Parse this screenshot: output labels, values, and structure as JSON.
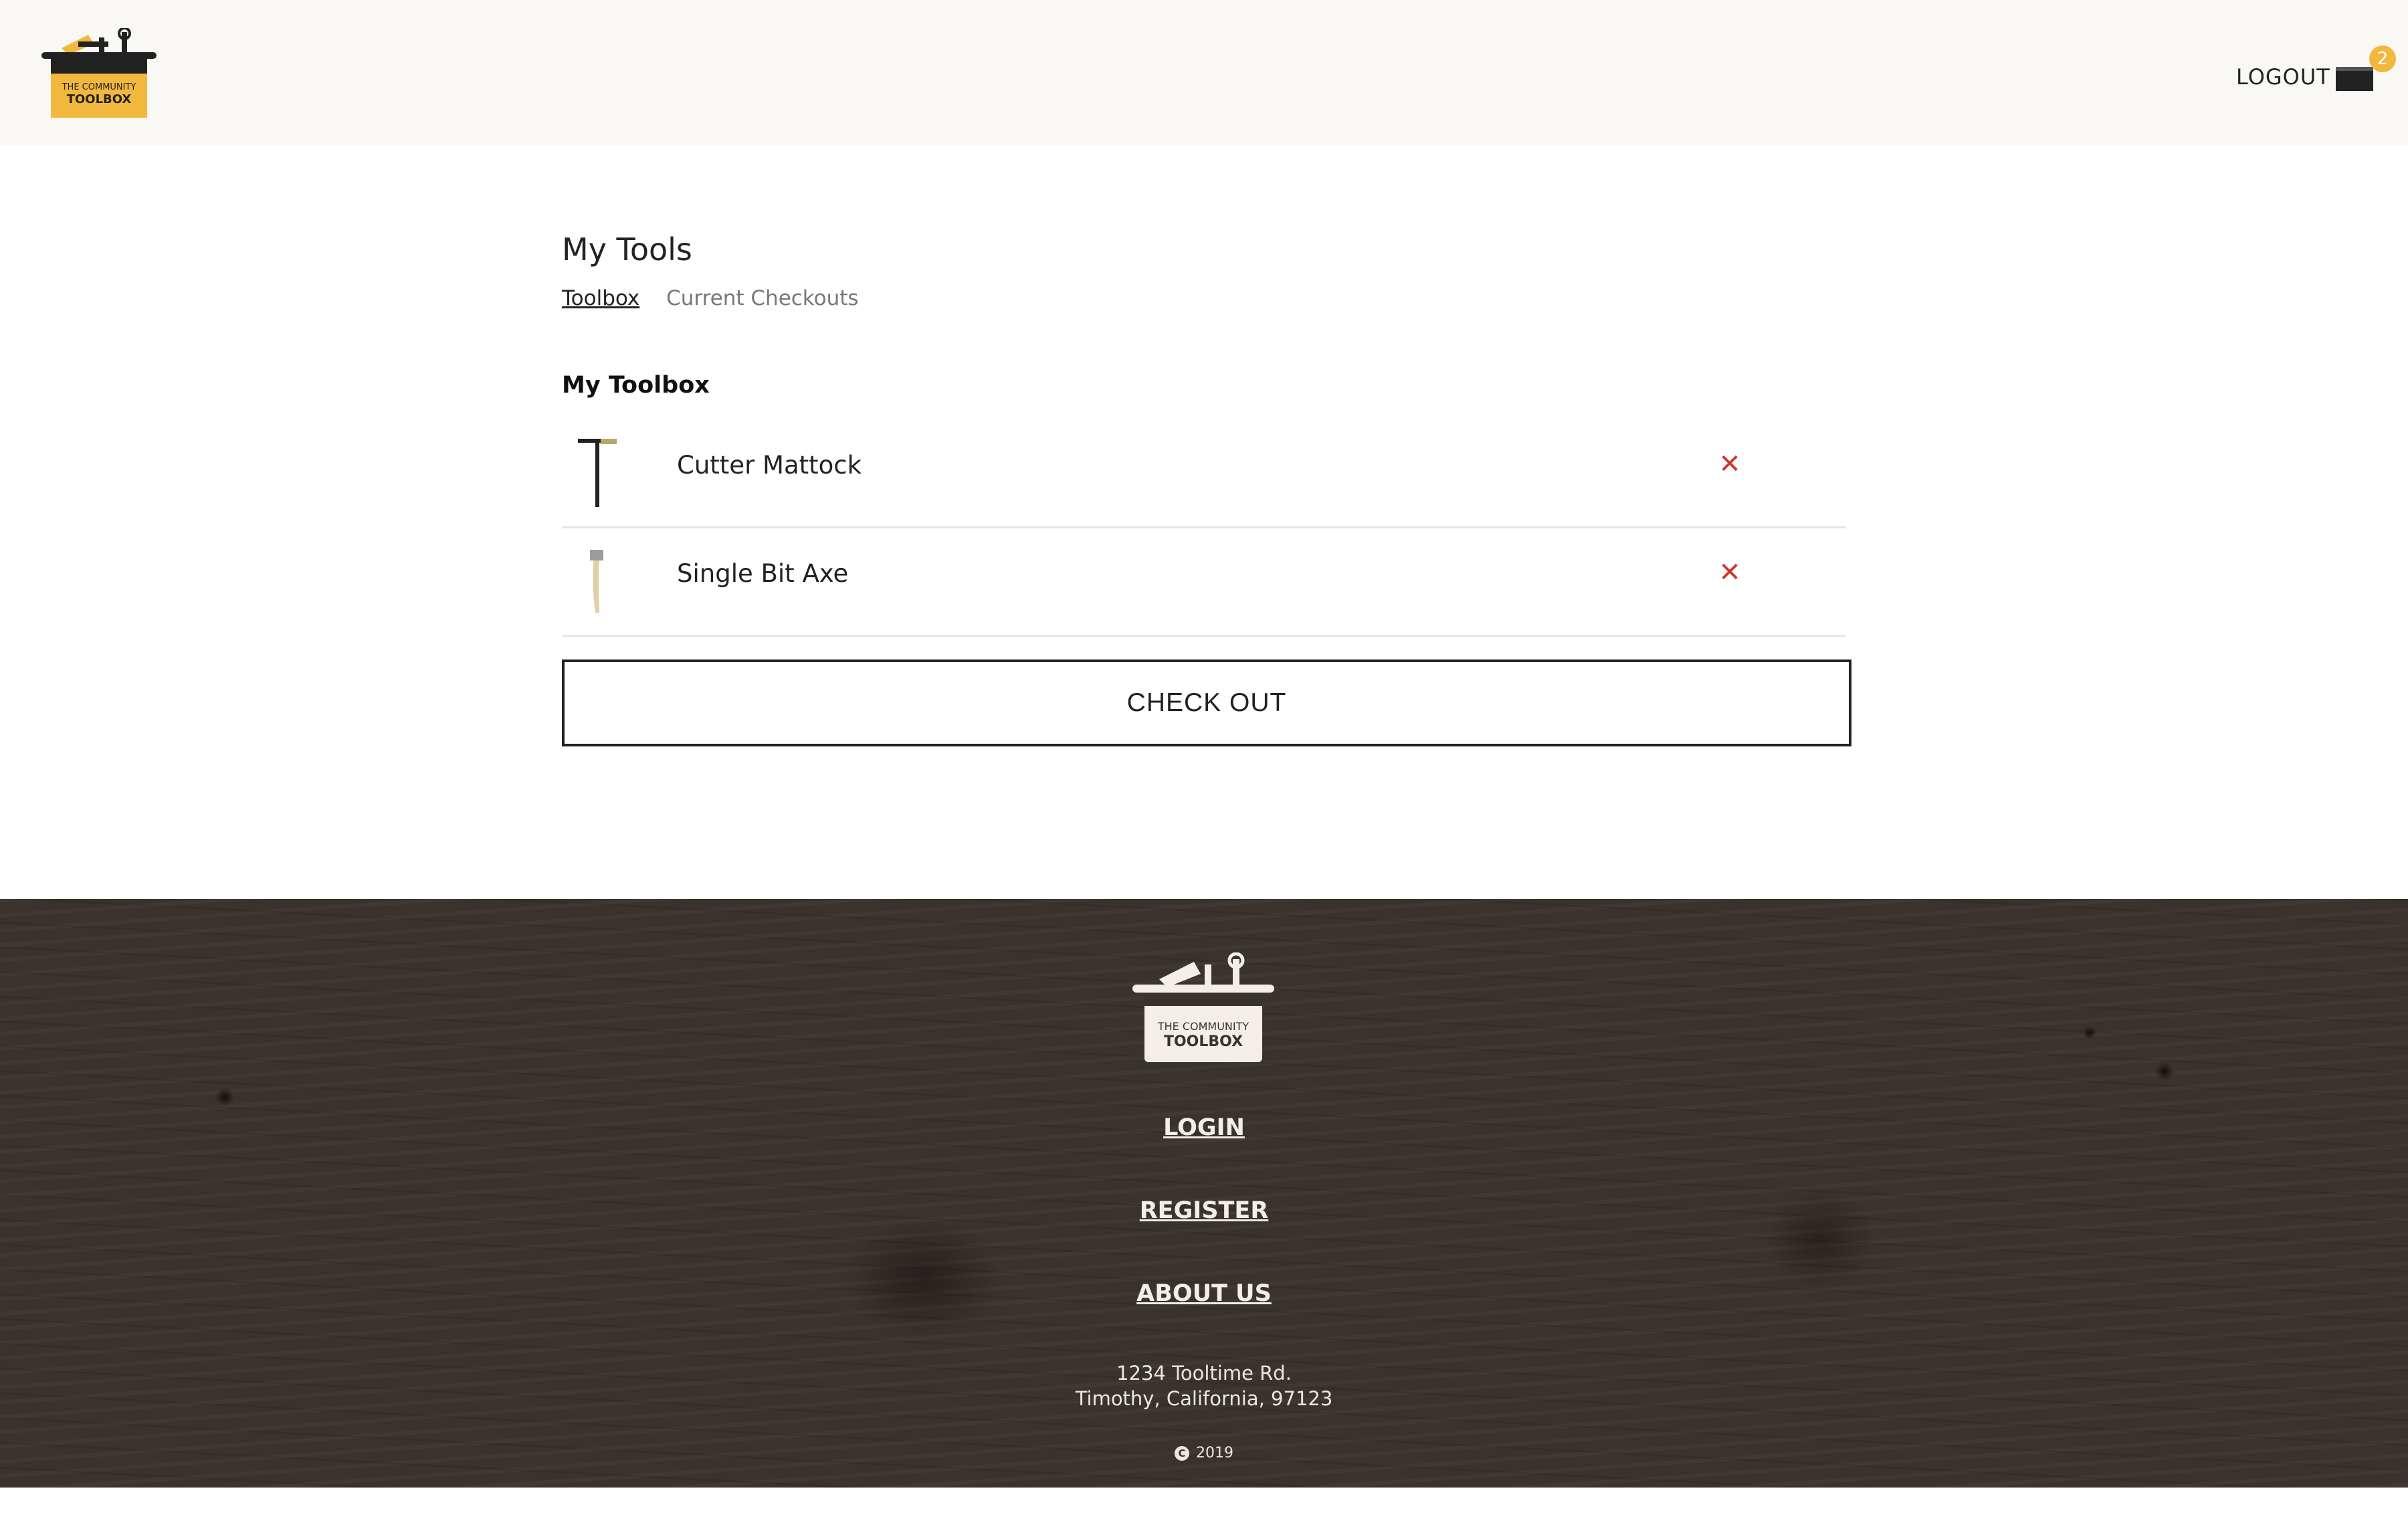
{
  "header": {
    "logo_line1": "THE COMMUNITY",
    "logo_line2": "TOOLBOX",
    "logout_label": "LOGOUT",
    "cart_count": "2"
  },
  "main": {
    "title": "My Tools",
    "tabs": [
      {
        "label": "Toolbox",
        "active": true
      },
      {
        "label": "Current Checkouts",
        "active": false
      }
    ],
    "section_title": "My Toolbox",
    "items": [
      {
        "name": "Cutter Mattock",
        "icon": "mattock-icon"
      },
      {
        "name": "Single Bit Axe",
        "icon": "axe-icon"
      }
    ],
    "remove_symbol": "✕",
    "checkout_label": "CHECK OUT"
  },
  "footer": {
    "logo_line1": "THE COMMUNITY",
    "logo_line2": "TOOLBOX",
    "links": [
      "LOGIN",
      "REGISTER",
      "ABOUT US"
    ],
    "address_line1": "1234 Tooltime Rd.",
    "address_line2": "Timothy, California, 97123",
    "copyright_year": "2019"
  },
  "colors": {
    "header_bg": "#f9f8f4",
    "accent": "#f2b83d",
    "remove": "#d0362e",
    "footer_bg": "#3a322d"
  }
}
